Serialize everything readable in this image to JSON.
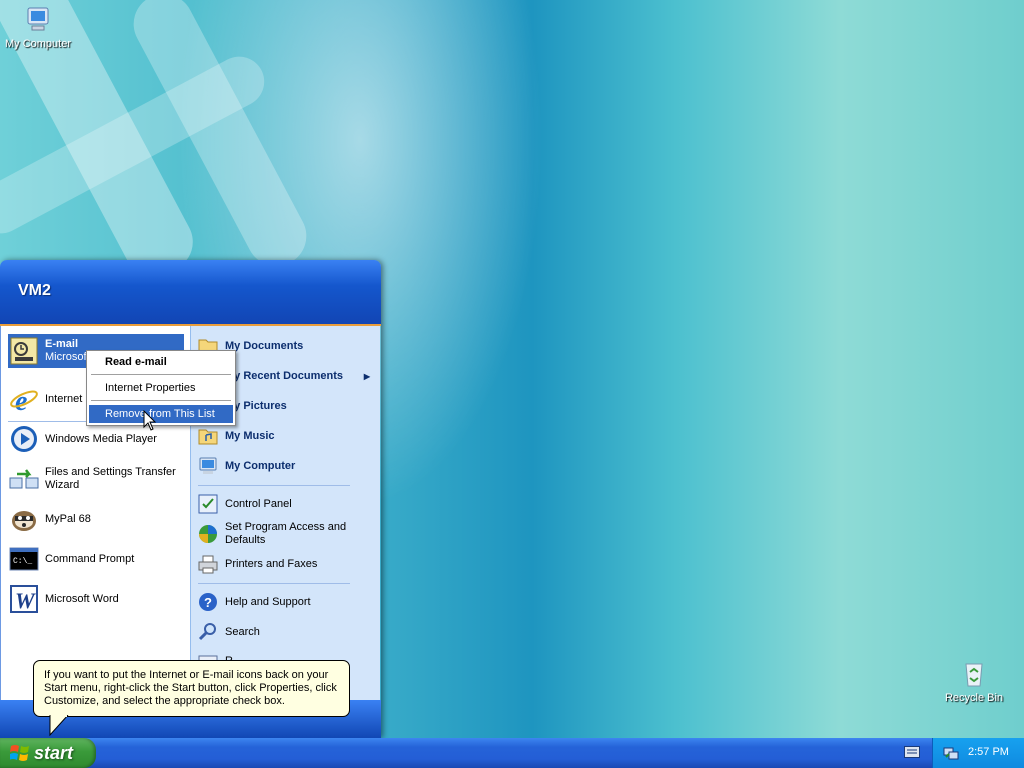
{
  "desktop": {
    "icons": [
      {
        "label": "My Computer",
        "icon": "my-computer-icon"
      },
      {
        "label": "Recycle Bin",
        "icon": "recycle-bin-icon"
      }
    ]
  },
  "start_menu": {
    "user_name": "VM2",
    "pinned": [
      {
        "title": "E-mail",
        "subtitle": "Microsof",
        "icon": "email-icon"
      },
      {
        "title": "Internet",
        "icon": "internet-explorer-icon"
      }
    ],
    "recent_programs": [
      {
        "label": "Windows Media Player",
        "icon": "media-player-icon"
      },
      {
        "label": "Files and Settings Transfer Wizard",
        "icon": "transfer-wizard-icon"
      },
      {
        "label": "MyPal 68",
        "icon": "mypal-icon"
      },
      {
        "label": "Command Prompt",
        "icon": "command-prompt-icon"
      },
      {
        "label": "Microsoft Word",
        "icon": "word-icon"
      }
    ],
    "right_places": [
      {
        "label": "My Documents",
        "icon": "my-documents-icon"
      },
      {
        "label": "My Recent Documents",
        "icon": "recent-documents-icon"
      },
      {
        "label": "My Pictures",
        "icon": "my-pictures-icon"
      },
      {
        "label": "My Music",
        "icon": "my-music-icon"
      },
      {
        "label": "My Computer",
        "icon": "my-computer-icon"
      }
    ],
    "right_settings": [
      {
        "label": "Control Panel",
        "icon": "control-panel-icon"
      },
      {
        "label": "Set Program Access and Defaults",
        "icon": "program-access-icon"
      },
      {
        "label": "Printers and Faxes",
        "icon": "printers-icon"
      }
    ],
    "right_help": [
      {
        "label": "Help and Support",
        "icon": "help-icon"
      },
      {
        "label": "Search",
        "icon": "search-icon"
      },
      {
        "label": "R",
        "icon": "run-icon"
      }
    ]
  },
  "context_menu": {
    "items": [
      {
        "label": "Read e-mail",
        "default": true
      },
      {
        "label": "Internet Properties"
      },
      {
        "label": "Remove from This List",
        "selected": true
      }
    ]
  },
  "balloon": {
    "text": "If you want to put the Internet or E-mail icons back on your Start menu, right-click the Start button, click Properties, click Customize, and select the appropriate check box."
  },
  "taskbar": {
    "start_label": "start",
    "clock": "2:57 PM"
  },
  "colors": {
    "selection": "#316ac5",
    "taskbar_blue": "#245ed6",
    "start_green": "#3a9a3a",
    "tooltip_bg": "#ffffe1"
  }
}
